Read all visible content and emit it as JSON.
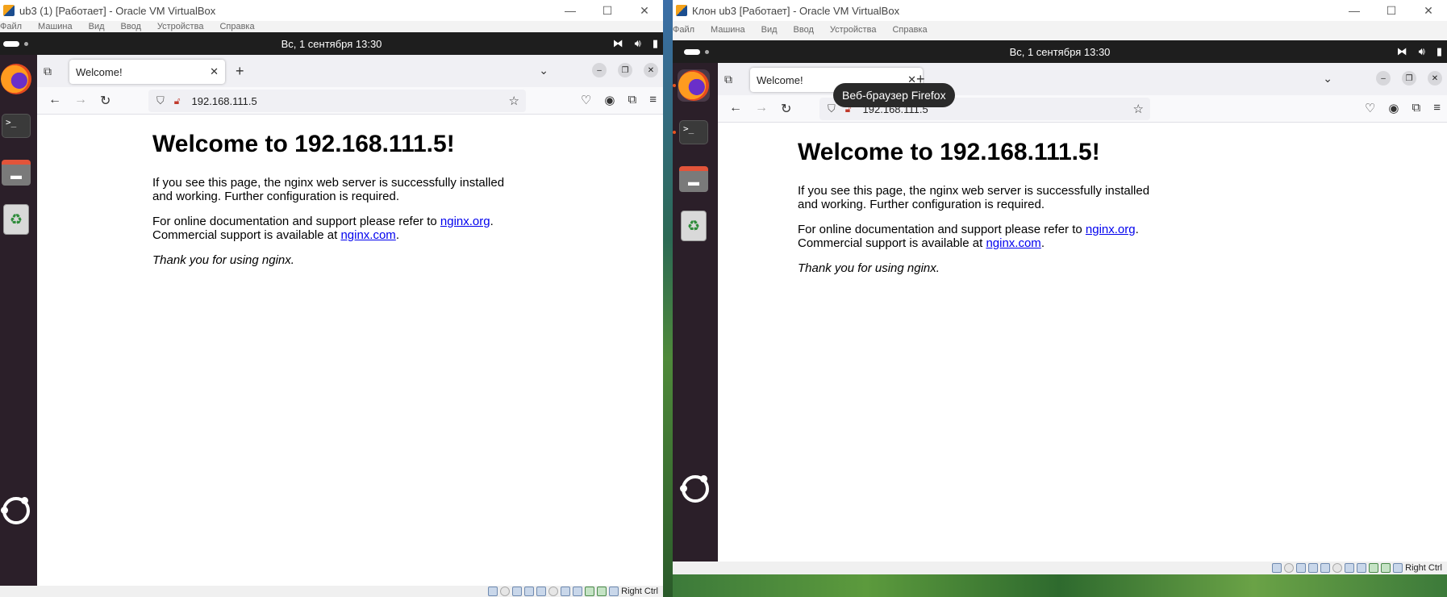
{
  "left_window": {
    "vbox_title": "ub3 (1) [Работает] - Oracle VM VirtualBox",
    "menu": [
      "Файл",
      "Машина",
      "Вид",
      "Ввод",
      "Устройства",
      "Справка"
    ],
    "datetime": "Вс, 1 сентября  13:30",
    "tab_title": "Welcome!",
    "url": "192.168.111.5",
    "status_host_key": "Right Ctrl"
  },
  "right_window": {
    "vbox_title": "Клон ub3 [Работает] - Oracle VM VirtualBox",
    "menu": [
      "Файл",
      "Машина",
      "Вид",
      "Ввод",
      "Устройства",
      "Справка"
    ],
    "datetime": "Вс, 1 сентября  13:30",
    "tab_title": "Welcome!",
    "url": "192.168.111.5",
    "tooltip": "Веб-браузер Firefox",
    "status_host_key": "Right Ctrl"
  },
  "page": {
    "heading": "Welcome to 192.168.111.5!",
    "para1": "If you see this page, the nginx web server is successfully installed and working. Further configuration is required.",
    "para2_prefix": "For online documentation and support please refer to ",
    "link_org": "nginx.org",
    "para2_mid": ".",
    "para2_line2": "Commercial support is available at ",
    "link_com": "nginx.com",
    "para2_end": ".",
    "thanks": "Thank you for using nginx."
  },
  "icons": {
    "firefox": "firefox-icon",
    "terminal": ">_",
    "files": "folder-icon",
    "trash": "♻",
    "tab_list": "⧉",
    "new_tab": "+",
    "back": "←",
    "forward": "→",
    "reload": "↻",
    "shield": "⛉",
    "star": "☆",
    "menu": "≡",
    "close": "✕",
    "minimize": "–",
    "restore": "❐",
    "chevron": "⌄"
  }
}
